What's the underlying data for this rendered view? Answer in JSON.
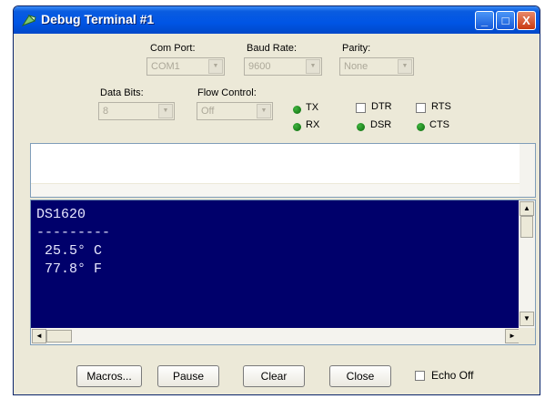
{
  "window": {
    "title": "Debug Terminal #1",
    "min_icon": "_",
    "max_icon": "□",
    "close_icon": "X"
  },
  "settings": {
    "com_port": {
      "label": "Com Port:",
      "value": "COM1"
    },
    "baud_rate": {
      "label": "Baud Rate:",
      "value": "9600"
    },
    "parity": {
      "label": "Parity:",
      "value": "None"
    },
    "data_bits": {
      "label": "Data Bits:",
      "value": "8"
    },
    "flow_control": {
      "label": "Flow Control:",
      "value": "Off"
    }
  },
  "indicators": {
    "tx": "TX",
    "rx": "RX",
    "dsr": "DSR",
    "cts": "CTS"
  },
  "lines": {
    "dtr": "DTR",
    "rts": "RTS"
  },
  "terminal": {
    "text": "DS1620\n---------\n 25.5° C\n 77.8° F"
  },
  "buttons": {
    "macros": "Macros...",
    "pause": "Pause",
    "clear": "Clear",
    "close": "Close",
    "echo_off": "Echo Off"
  },
  "colors": {
    "terminal_bg": "#00006b",
    "terminal_fg": "#e8e8ff",
    "led_on": "#1e9a1e",
    "titlebar": "#0055e5"
  }
}
